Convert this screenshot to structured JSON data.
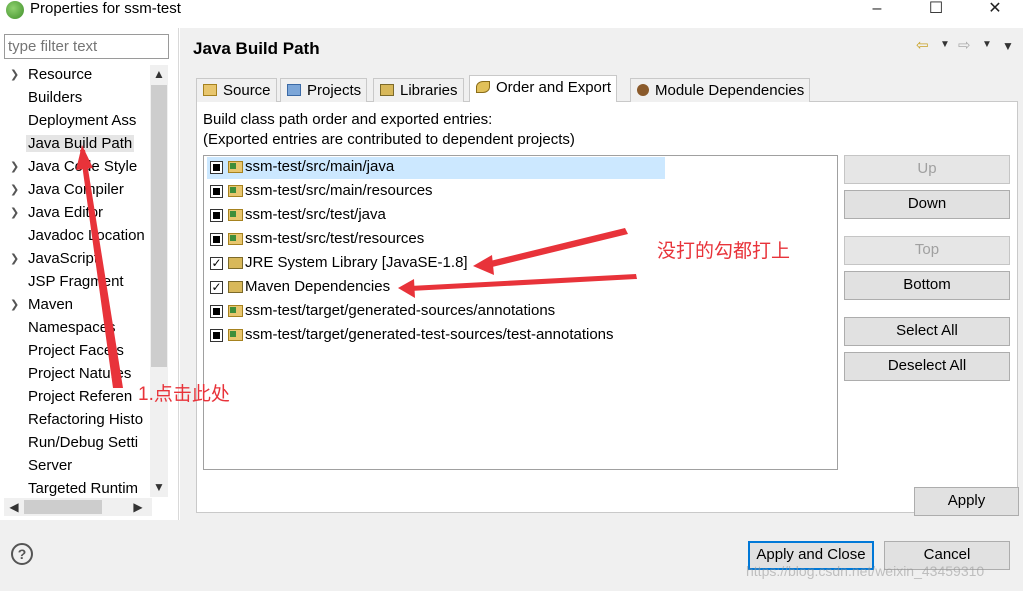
{
  "window": {
    "title": "Properties for ssm-test",
    "controls": [
      "–",
      "☐",
      "✕"
    ]
  },
  "filter": {
    "placeholder": "type filter text"
  },
  "tree": {
    "items": [
      {
        "label": "Resource",
        "expandable": true
      },
      {
        "label": "Builders",
        "expandable": false
      },
      {
        "label": "Deployment Ass",
        "expandable": false
      },
      {
        "label": "Java Build Path",
        "expandable": false,
        "selected": true
      },
      {
        "label": "Java Code Style",
        "expandable": true
      },
      {
        "label": "Java Compiler",
        "expandable": true
      },
      {
        "label": "Java Editor",
        "expandable": true
      },
      {
        "label": "Javadoc Location",
        "expandable": false
      },
      {
        "label": "JavaScript",
        "expandable": true
      },
      {
        "label": "JSP Fragment",
        "expandable": false
      },
      {
        "label": "Maven",
        "expandable": true
      },
      {
        "label": "Namespaces",
        "expandable": false
      },
      {
        "label": "Project Facets",
        "expandable": false
      },
      {
        "label": "Project Natures",
        "expandable": false
      },
      {
        "label": "Project Referen",
        "expandable": false
      },
      {
        "label": "Refactoring Histo",
        "expandable": false
      },
      {
        "label": "Run/Debug Setti",
        "expandable": false
      },
      {
        "label": "Server",
        "expandable": false
      },
      {
        "label": "Targeted Runtim",
        "expandable": false
      }
    ]
  },
  "page": {
    "title": "Java Build Path"
  },
  "tabs": [
    {
      "label": "Source",
      "icon": "source-folder-icon"
    },
    {
      "label": "Projects",
      "icon": "projects-icon"
    },
    {
      "label": "Libraries",
      "icon": "libraries-icon"
    },
    {
      "label": "Order and Export",
      "icon": "order-export-icon",
      "active": true
    },
    {
      "label": "Module Dependencies",
      "icon": "module-icon"
    }
  ],
  "description": {
    "line1": "Build class path order and exported entries:",
    "line2": "(Exported entries are contributed to dependent projects)"
  },
  "entries": [
    {
      "label": "ssm-test/src/main/java",
      "checked": false,
      "icon": "source-folder-icon",
      "selected": true
    },
    {
      "label": "ssm-test/src/main/resources",
      "checked": false,
      "icon": "source-folder-icon"
    },
    {
      "label": "ssm-test/src/test/java",
      "checked": false,
      "icon": "source-folder-icon"
    },
    {
      "label": "ssm-test/src/test/resources",
      "checked": false,
      "icon": "source-folder-icon"
    },
    {
      "label": "JRE System Library [JavaSE-1.8]",
      "checked": true,
      "icon": "library-icon"
    },
    {
      "label": "Maven Dependencies",
      "checked": true,
      "icon": "library-icon"
    },
    {
      "label": "ssm-test/target/generated-sources/annotations",
      "checked": false,
      "icon": "source-folder-icon"
    },
    {
      "label": "ssm-test/target/generated-test-sources/test-annotations",
      "checked": false,
      "icon": "source-folder-icon"
    }
  ],
  "side_buttons": {
    "up": "Up",
    "down": "Down",
    "top": "Top",
    "bottom": "Bottom",
    "select_all": "Select All",
    "deselect_all": "Deselect All"
  },
  "apply": "Apply",
  "footer": {
    "help": "?",
    "apply_close": "Apply and Close",
    "cancel": "Cancel",
    "watermark": "https://blog.csdn.net/weixin_43459310"
  },
  "annotations": {
    "click_here": "1.点击此处",
    "check_all": "没打的勾都打上",
    "color": "#e8333a"
  }
}
